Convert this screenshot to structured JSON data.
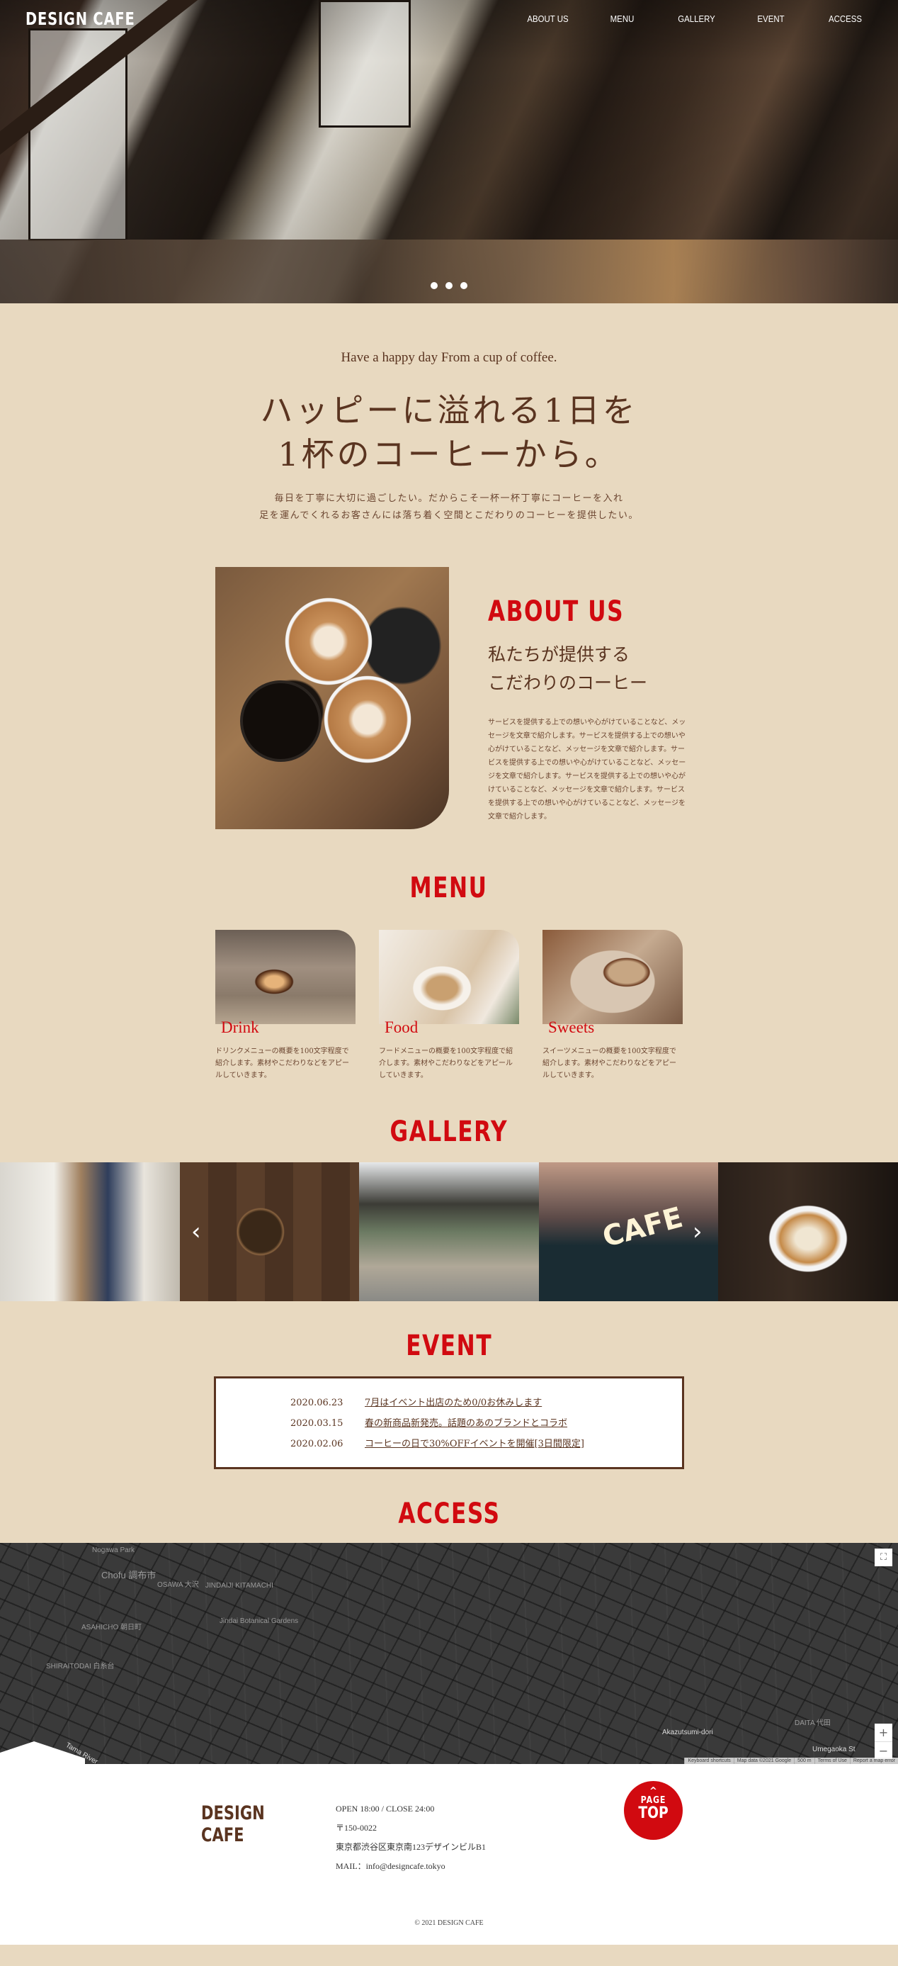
{
  "header": {
    "logo": "DESIGN CAFE",
    "nav": [
      "ABOUT US",
      "MENU",
      "GALLERY",
      "EVENT",
      "ACCESS"
    ],
    "slider_dots": 3
  },
  "intro": {
    "tagline": "Have a happy day From a cup of coffee.",
    "headline_line1": "ハッピーに溢れる1日を",
    "headline_line2": "1杯のコーヒーから。",
    "body_line1": "毎日を丁寧に大切に過ごしたい。だからこそ一杯一杯丁寧にコーヒーを入れ",
    "body_line2": "足を運んでくれるお客さんには落ち着く空間とこだわりのコーヒーを提供したい。"
  },
  "about": {
    "title": "ABOUT US",
    "subtitle_line1": "私たちが提供する",
    "subtitle_line2": "こだわりのコーヒー",
    "body": "サービスを提供する上での想いや心がけていることなど、メッセージを文章で紹介します。サービスを提供する上での想いや心がけていることなど、メッセージを文章で紹介します。サービスを提供する上での想いや心がけていることなど、メッセージを文章で紹介します。サービスを提供する上での想いや心がけていることなど、メッセージを文章で紹介します。サービスを提供する上での想いや心がけていることなど、メッセージを文章で紹介します。"
  },
  "menu": {
    "title": "MENU",
    "items": [
      {
        "name": "Drink",
        "desc": "ドリンクメニューの概要を100文字程度で紹介します。素材やこだわりなどをアピールしていきます。"
      },
      {
        "name": "Food",
        "desc": "フードメニューの概要を100文字程度で紹介します。素材やこだわりなどをアピールしていきます。"
      },
      {
        "name": "Sweets",
        "desc": "スイーツメニューの概要を100文字程度で紹介します。素材やこだわりなどをアピールしていきます。"
      }
    ]
  },
  "gallery": {
    "title": "GALLERY",
    "prev": "‹",
    "next": "›",
    "cafe_sign": "CAFE"
  },
  "event": {
    "title": "EVENT",
    "items": [
      {
        "date": "2020.06.23",
        "text": "7月はイベント出店のため0/0お休みします"
      },
      {
        "date": "2020.03.15",
        "text": "春の新商品新発売。話題のあのブランドとコラボ"
      },
      {
        "date": "2020.02.06",
        "text": "コーヒーの日で30%OFFイベントを開催[3日間限定]"
      }
    ]
  },
  "access": {
    "title": "ACCESS",
    "map": {
      "labels": [
        "Chofu 調布市",
        "Nogawa Park",
        "OSAWA 大沢",
        "JINDAIJI KITAMACHI",
        "Jindai Botanical Gardens",
        "ASAHICHO 朝日町",
        "SHIRAITODAI 白糸台",
        "DAITA 代田",
        "Akazutsumi-dori",
        "Umegaoka St",
        "Tama River"
      ],
      "zoom_in": "+",
      "zoom_out": "−",
      "fullscreen": "⛶",
      "google": "Google",
      "attribution": [
        "Keyboard shortcuts",
        "Map data ©2021 Google",
        "500 m",
        "Terms of Use",
        "Report a map error"
      ]
    }
  },
  "footer": {
    "logo": "DESIGN CAFE",
    "hours": "OPEN 18:00 / CLOSE 24:00",
    "postal": "〒150-0022",
    "address": "東京都渋谷区東京南123デザインビルB1",
    "mail": "MAIL：info@designcafe.tokyo",
    "page_top_caret": "^",
    "page_top_line1": "PAGE",
    "page_top_line2": "TOP",
    "copyright": "© 2021 DESIGN CAFE"
  },
  "colors": {
    "accent_red": "#d10a10",
    "brown_text": "#5a3420",
    "background_beige": "#e8d9c0"
  }
}
